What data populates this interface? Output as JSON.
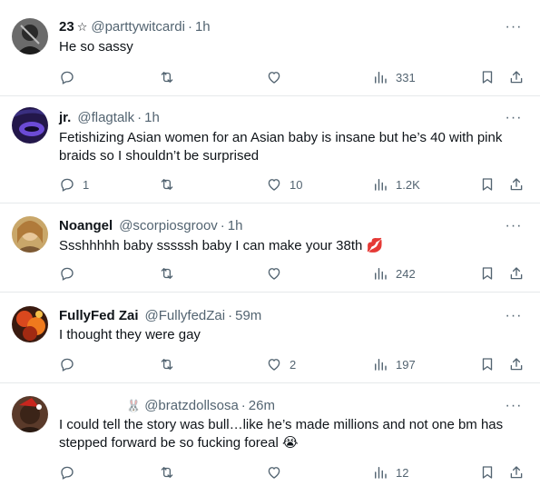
{
  "tweets": [
    {
      "name": "23",
      "badge": "☆",
      "handle": "@parttywitcardi",
      "time": "1h",
      "text": "He so sassy",
      "replies": "",
      "retweets": "",
      "likes": "",
      "views": "331",
      "more": "···"
    },
    {
      "name": "jr.",
      "badge": "",
      "handle": "@flagtalk",
      "time": "1h",
      "text": "Fetishizing Asian women for an Asian baby is insane but he’s 40 with pink braids so I shouldn’t be surprised",
      "replies": "1",
      "retweets": "",
      "likes": "10",
      "views": "1.2K",
      "more": "···"
    },
    {
      "name": "Noangel",
      "badge": "",
      "handle": "@scorpiosgroov",
      "time": "1h",
      "text": "Ssshhhhh baby sssssh baby I can make your 38th 💋",
      "replies": "",
      "retweets": "",
      "likes": "",
      "views": "242",
      "more": "···"
    },
    {
      "name": "FullyFed Zai",
      "badge": "",
      "handle": "@FullyfedZai",
      "time": "59m",
      "text": "I thought they were gay",
      "replies": "",
      "retweets": "",
      "likes": "2",
      "views": "197",
      "more": "···"
    },
    {
      "name": "",
      "badge": "🐰",
      "handle": "@bratzdollsosa",
      "time": "26m",
      "text": "I could tell the story was bull…like he’s made millions and not one bm has stepped forward be so fucking foreal 😭",
      "replies": "",
      "retweets": "",
      "likes": "",
      "views": "12",
      "more": "···"
    }
  ],
  "separator": "·",
  "colors": {
    "text": "#0f1419",
    "muted": "#536471",
    "border": "#e6e9eb"
  },
  "icons": [
    "reply-icon",
    "retweet-icon",
    "like-icon",
    "views-icon",
    "bookmark-icon",
    "share-icon",
    "more-icon"
  ]
}
